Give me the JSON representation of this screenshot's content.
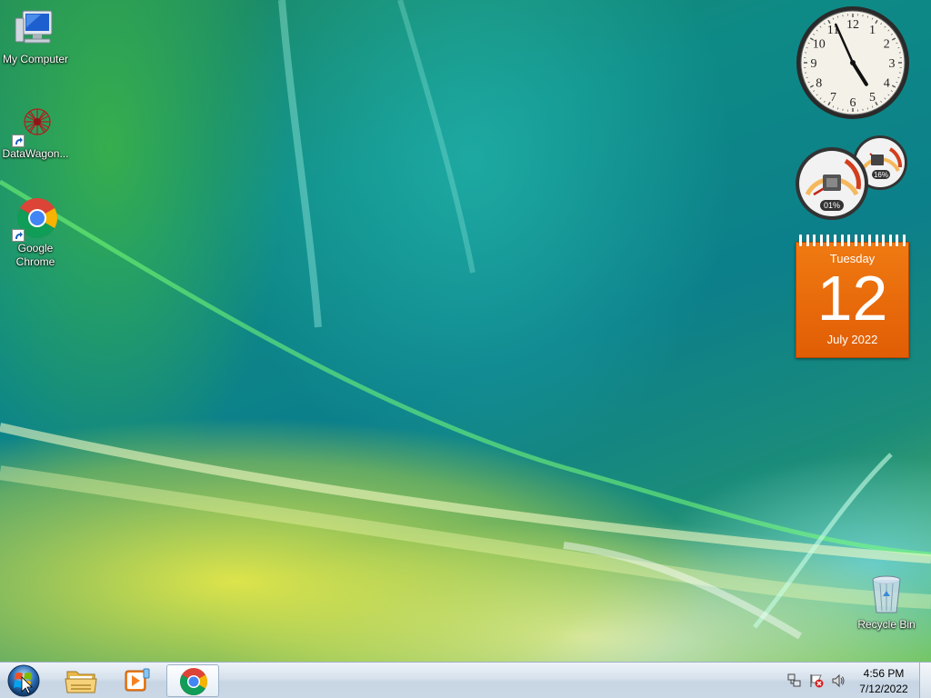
{
  "desktop": {
    "icons": [
      {
        "label": "My Computer",
        "icon": "computer-icon"
      },
      {
        "label": "DataWagon...",
        "icon": "datawagon-icon"
      },
      {
        "label": "Google Chrome",
        "icon": "chrome-icon"
      },
      {
        "label": "Recycle Bin",
        "icon": "recycle-bin-icon"
      }
    ]
  },
  "gadgets": {
    "clock": {
      "numerals": [
        "12",
        "1",
        "2",
        "3",
        "4",
        "5",
        "6",
        "7",
        "8",
        "9",
        "10",
        "11"
      ],
      "hour": 4,
      "minute": 56
    },
    "cpu_meter": {
      "cpu_percent": "01%",
      "memory_percent": "16%"
    },
    "calendar": {
      "weekday": "Tuesday",
      "day": "12",
      "month_year": "July 2022",
      "color": "#ec6a0b"
    }
  },
  "taskbar": {
    "start": {
      "icon": "windows-start-icon"
    },
    "pinned": [
      {
        "name": "explorer",
        "icon": "folder-icon"
      },
      {
        "name": "media-player",
        "icon": "media-player-icon"
      },
      {
        "name": "chrome",
        "icon": "chrome-icon",
        "active": true
      }
    ],
    "tray": {
      "icons": [
        "network-icon",
        "action-center-flag-icon",
        "volume-icon"
      ],
      "time": "4:56 PM",
      "date": "7/12/2022"
    }
  }
}
